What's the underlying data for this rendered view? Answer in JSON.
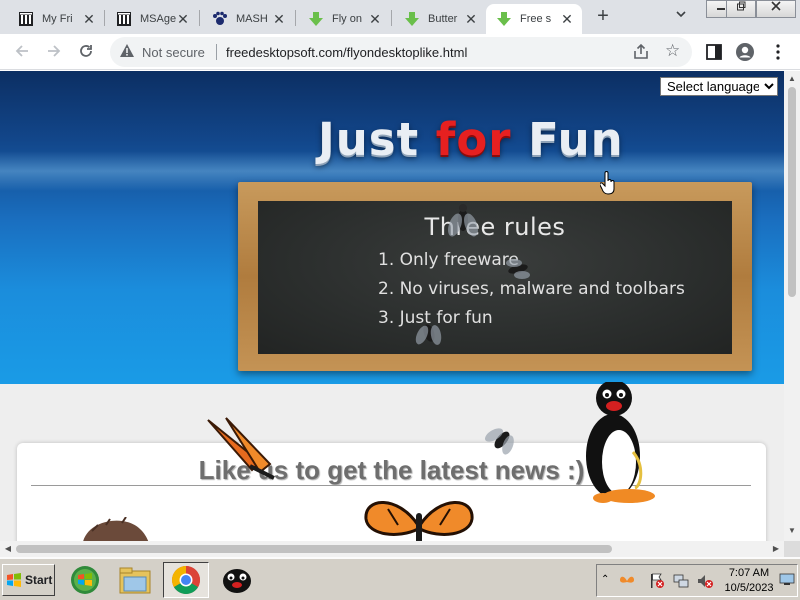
{
  "tabs": [
    {
      "title": "My Fri",
      "icon": "museum-icon",
      "active": false
    },
    {
      "title": "MSAge",
      "icon": "museum-icon",
      "active": false
    },
    {
      "title": "MASH",
      "icon": "paw-icon",
      "active": false
    },
    {
      "title": "Fly on",
      "icon": "download-arrow-icon",
      "active": false
    },
    {
      "title": "Butter",
      "icon": "download-arrow-icon",
      "active": false
    },
    {
      "title": "Free s",
      "icon": "download-arrow-icon",
      "active": true
    }
  ],
  "tab_close_glyph": "✕",
  "new_tab_glyph": "+",
  "address_bar": {
    "security_label": "Not secure",
    "url": "freedesktopsoft.com/flyondesktoplike.html"
  },
  "page": {
    "language_select": {
      "selected": "Select language",
      "options": [
        "Select language"
      ]
    },
    "hero_title": {
      "word1": "Just",
      "word2": "for",
      "word3": "Fun"
    },
    "board": {
      "title": "Three rules",
      "rules": [
        "1. Only freeware",
        "2. No viruses, malware and toolbars",
        "3. Just for fun"
      ]
    },
    "panel_heading": "Like us to get the latest news :)"
  },
  "taskbar": {
    "start_label": "Start",
    "clock_time": "7:07 AM",
    "clock_date": "10/5/2023"
  },
  "colors": {
    "hero_blue": "#1a6fc0",
    "title_red": "#e62020",
    "board_wood": "#c89a5c",
    "chalkboard": "#2b2e2d"
  }
}
